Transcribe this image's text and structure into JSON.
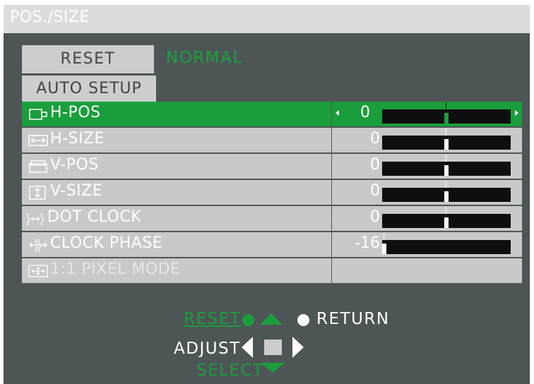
{
  "title": "POS./SIZE",
  "buttons": {
    "reset": "RESET",
    "auto_setup": "AUTO SETUP"
  },
  "status": "NORMAL",
  "items": [
    {
      "label": "H-POS",
      "value": "0",
      "level": 0,
      "selected": true,
      "icon": "h-pos-icon"
    },
    {
      "label": "H-SIZE",
      "value": "0",
      "level": 0,
      "icon": "h-size-icon"
    },
    {
      "label": "V-POS",
      "value": "0",
      "level": 0,
      "icon": "v-pos-icon"
    },
    {
      "label": "V-SIZE",
      "value": "0",
      "level": 0,
      "icon": "v-size-icon"
    },
    {
      "label": "DOT CLOCK",
      "value": "0",
      "level": 0,
      "icon": "dot-clock-icon"
    },
    {
      "label": "CLOCK PHASE",
      "value": "-16",
      "level": -16,
      "icon": "clock-phase-icon"
    },
    {
      "label": "1:1 PIXEL MODE",
      "disabled": true,
      "icon": "pixel-mode-icon"
    }
  ],
  "nav": {
    "reset": "RESET",
    "return": "RETURN",
    "adjust": "ADJUST",
    "select": "SELECT"
  },
  "colors": {
    "accent": "#1a9e3c",
    "panel": "#4d5556",
    "row": "#c9c9c9",
    "bar": "#0e0e0e"
  }
}
